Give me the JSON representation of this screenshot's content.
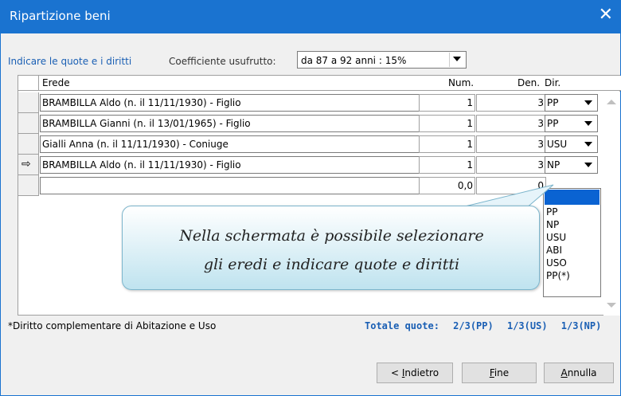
{
  "window": {
    "title": "Ripartizione beni",
    "close_glyph": "✕"
  },
  "header": {
    "link_text": "Indicare le quote e i diritti",
    "coef_label": "Coefficiente usufrutto:",
    "coef_value": "da 87 a 92 anni :  15%"
  },
  "grid": {
    "columns": {
      "erede": "Erede",
      "num": "Num.",
      "den": "Den.",
      "dir": "Dir."
    },
    "rows": [
      {
        "erede": "BRAMBILLA Aldo (n. il 11/11/1930) - Figlio",
        "num": "1",
        "den": "3",
        "dir": "PP",
        "current": false
      },
      {
        "erede": "BRAMBILLA Gianni (n. il 13/01/1965) - Figlio",
        "num": "1",
        "den": "3",
        "dir": "PP",
        "current": false
      },
      {
        "erede": "Gialli Anna (n. il 11/11/1930) - Coniuge",
        "num": "1",
        "den": "3",
        "dir": "USU",
        "current": false
      },
      {
        "erede": "BRAMBILLA Aldo (n. il 11/11/1930) - Figlio",
        "num": "1",
        "den": "3",
        "dir": "NP",
        "current": true
      },
      {
        "erede": "",
        "num": "0,0",
        "den": "0",
        "dir": "",
        "current": false
      }
    ],
    "current_row_glyph": "⇨",
    "dir_options": [
      "",
      "PP",
      "NP",
      "USU",
      "ABI",
      "USO",
      "PP(*)"
    ]
  },
  "tooltip": {
    "line1": "Nella schermata è possibile selezionare",
    "line2": "gli eredi e indicare quote e diritti"
  },
  "footer": {
    "note": "*Diritto complementare di Abitazione e Uso",
    "total_label": "Totale quote:",
    "totals": [
      "2/3(PP)",
      "1/3(US)",
      "1/3(NP)"
    ]
  },
  "buttons": {
    "back": {
      "prefix": "< ",
      "mnemonic": "I",
      "rest": "ndietro"
    },
    "finish": {
      "prefix": "",
      "mnemonic": "F",
      "rest": "ine"
    },
    "cancel": {
      "prefix": "",
      "mnemonic": "A",
      "rest": "nnulla"
    }
  }
}
